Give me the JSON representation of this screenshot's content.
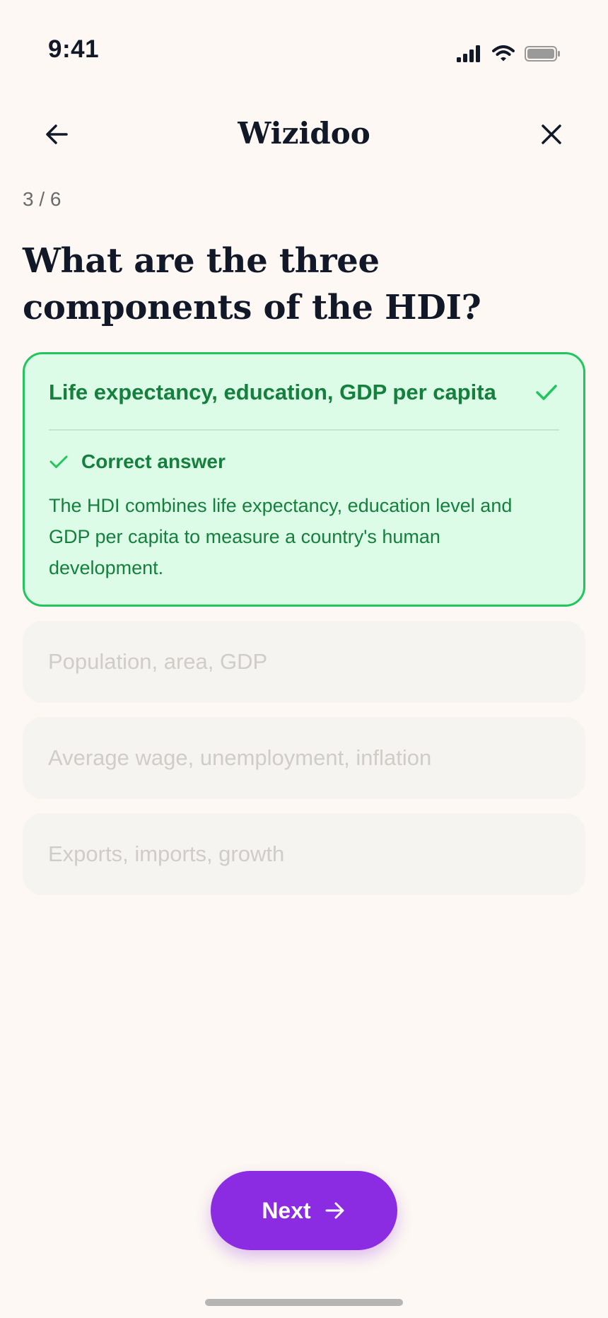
{
  "status_bar": {
    "time": "9:41",
    "icons": [
      "signal-icon",
      "wifi-icon",
      "battery-icon"
    ]
  },
  "header": {
    "title": "Wizidoo",
    "back_icon": "arrow-left-icon",
    "close_icon": "close-icon"
  },
  "progress": {
    "text": "3 / 6"
  },
  "question": {
    "text": "What are the three components of the HDI?"
  },
  "answers": [
    {
      "text": "Life expectancy, education, GDP per capita",
      "state": "correct",
      "feedback_title": "Correct answer",
      "feedback_body": "The HDI combines life expectancy, education level and GDP per capita to measure a country's human development."
    },
    {
      "text": "Population, area, GDP",
      "state": "disabled"
    },
    {
      "text": "Average wage, unemployment, inflation",
      "state": "disabled"
    },
    {
      "text": "Exports, imports, growth",
      "state": "disabled"
    }
  ],
  "next_button": {
    "label": "Next",
    "icon": "arrow-right-icon"
  },
  "colors": {
    "background": "#fdf8f3",
    "correct_bg": "#dcfce7",
    "correct_border": "#22c55e",
    "correct_text": "#15803d",
    "accent": "#8b2be2",
    "disabled_bg": "#f6f4f1",
    "disabled_text": "#d0ccc8"
  }
}
